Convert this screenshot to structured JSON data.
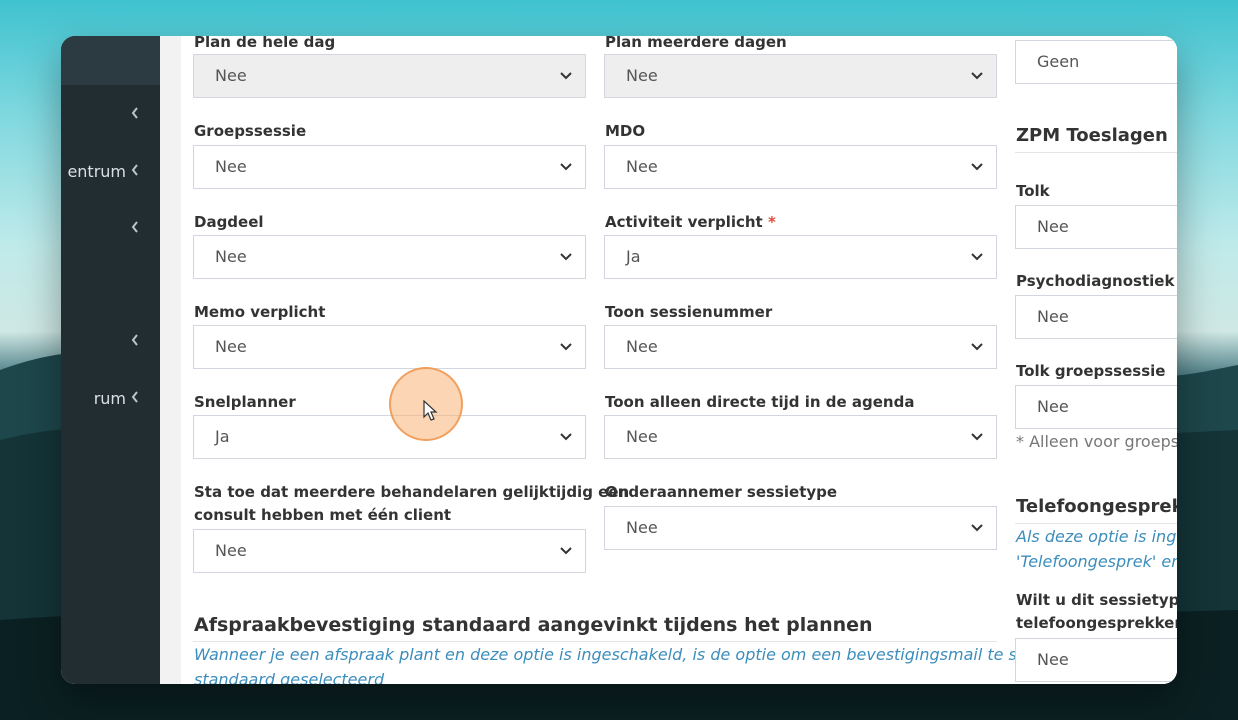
{
  "sidebar": {
    "items": [
      {
        "label": ""
      },
      {
        "label": "entrum"
      },
      {
        "label": ""
      },
      {
        "label": ""
      },
      {
        "label": "rum"
      }
    ]
  },
  "form": {
    "col1": [
      {
        "label": "Plan de hele dag",
        "value": "Nee",
        "disabled": true
      },
      {
        "label": "Groepssessie",
        "value": "Nee"
      },
      {
        "label": "Dagdeel",
        "value": "Nee"
      },
      {
        "label": "Memo verplicht",
        "value": "Nee"
      },
      {
        "label": "Snelplanner",
        "value": "Ja"
      },
      {
        "label_line1": "Sta toe dat meerdere behandelaren gelijktijdig een",
        "label_line2": "consult hebben met één client",
        "value": "Nee"
      }
    ],
    "col2": [
      {
        "label": "Plan meerdere dagen",
        "value": "Nee",
        "disabled": true
      },
      {
        "label": "MDO",
        "value": "Nee"
      },
      {
        "label": "Activiteit verplicht",
        "required_mark": "*",
        "value": "Ja"
      },
      {
        "label": "Toon sessienummer",
        "value": "Nee"
      },
      {
        "label": "Toon alleen directe tijd in de agenda",
        "value": "Nee"
      },
      {
        "label": "Onderaannemer sessietype",
        "value": "Nee"
      }
    ]
  },
  "confirmation": {
    "title": "Afspraakbevestiging standaard aangevinkt tijdens het plannen",
    "help_line1": "Wanneer je een afspraak plant en deze optie is ingeschakeld, is de optie om een bevestigingsmail te sturen",
    "help_line2": "standaard geselecteerd"
  },
  "right": {
    "top_value": "Geen",
    "zpm_title": "ZPM Toeslagen",
    "fields": [
      {
        "label": "Tolk",
        "value": "Nee"
      },
      {
        "label": "Psychodiagnostiek",
        "value": "Nee"
      },
      {
        "label": "Tolk groepssessie",
        "value": "Nee"
      }
    ],
    "group_note": "* Alleen voor groepsse",
    "phone_title": "Telefoongesprek",
    "phone_help_line1": "Als deze optie is ingesc",
    "phone_help_line2": "'Telefoongesprek' en w",
    "phone_question_line1": "Wilt u dit sessietype ge",
    "phone_question_line2": "telefoongesprekken?",
    "phone_value": "Nee"
  },
  "colors": {
    "sidebar_bg": "#222d32",
    "link_help": "#3c8dbc",
    "required": "#dd4b39",
    "cursor_ring": "#f8b276"
  }
}
